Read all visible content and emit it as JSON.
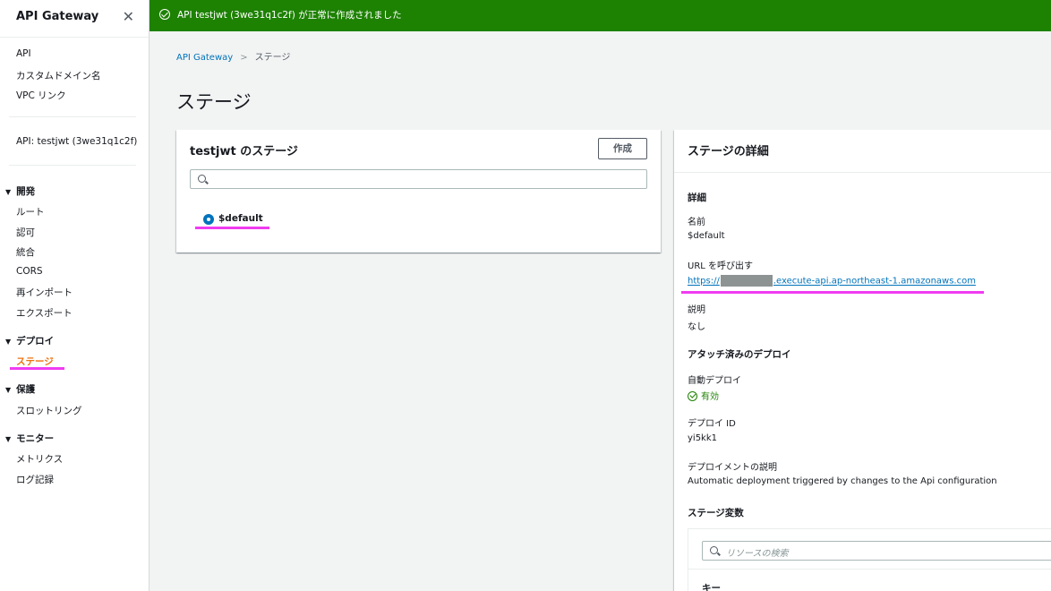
{
  "sidebar": {
    "title": "API Gateway",
    "top_links": [
      "API",
      "カスタムドメイン名",
      "VPC リンク"
    ],
    "api_label": "API: testjwt (3we31q1c2f)",
    "groups": [
      {
        "label": "開発",
        "items": [
          "ルート",
          "認可",
          "統合",
          "CORS",
          "再インポート",
          "エクスポート"
        ]
      },
      {
        "label": "デプロイ",
        "items": [
          "ステージ"
        ]
      },
      {
        "label": "保護",
        "items": [
          "スロットリング"
        ]
      },
      {
        "label": "モニター",
        "items": [
          "メトリクス",
          "ログ記録"
        ]
      }
    ]
  },
  "flash": {
    "message": "API testjwt (3we31q1c2f) が正常に作成されました"
  },
  "breadcrumb": {
    "root": "API Gateway",
    "current": "ステージ"
  },
  "page": {
    "title": "ステージ"
  },
  "stages_panel": {
    "title": "testjwt のステージ",
    "create_label": "作成",
    "stages": [
      "$default"
    ]
  },
  "details_panel": {
    "title": "ステージの詳細",
    "section_details": "詳細",
    "name_label": "名前",
    "name_value": "$default",
    "url_label": "URL を呼び出す",
    "url_prefix": "https://",
    "url_suffix": ".execute-api.ap-northeast-1.amazonaws.com",
    "desc_label": "説明",
    "desc_value": "なし",
    "section_deploy": "アタッチ済みのデプロイ",
    "auto_deploy_label": "自動デプロイ",
    "auto_deploy_value": "有効",
    "deploy_id_label": "デプロイ ID",
    "deploy_id_value": "yi5kk1",
    "deploy_desc_label": "デプロイメントの説明",
    "deploy_desc_value": "Automatic deployment triggered by changes to the Api configuration",
    "section_vars": "ステージ変数",
    "vars_search_placeholder": "リソースの検索",
    "vars_col_key": "キー"
  },
  "colors": {
    "flash": "#1d8102",
    "link": "#0073bb",
    "active": "#ec7211",
    "annotation": "#f03cf0"
  }
}
